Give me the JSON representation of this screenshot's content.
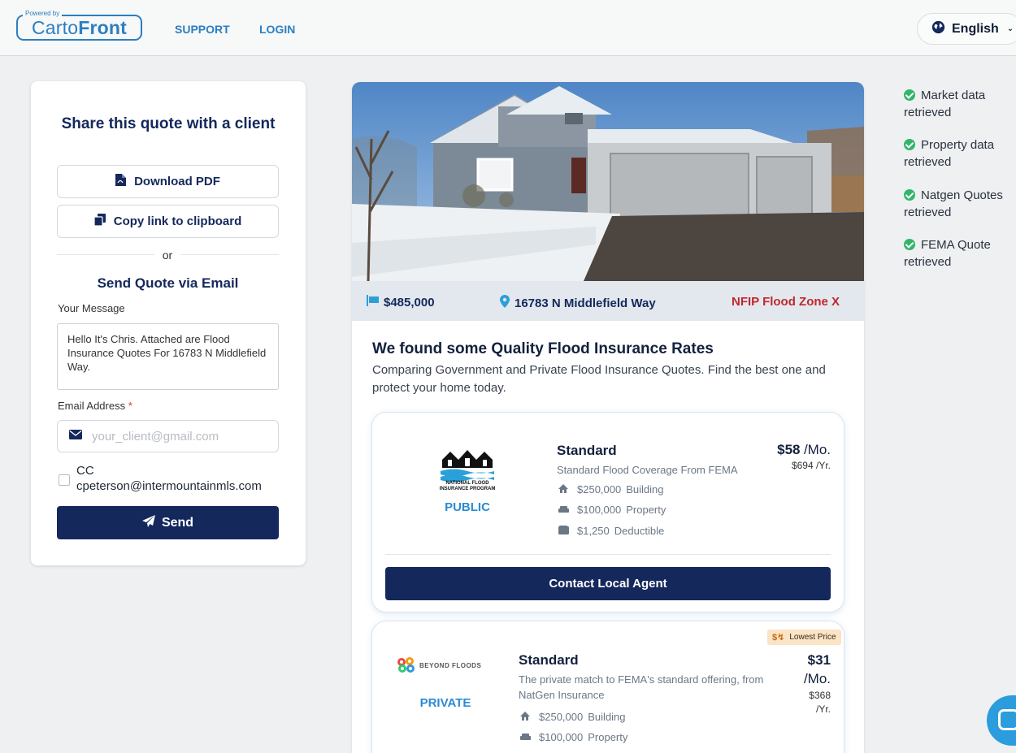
{
  "header": {
    "logo_powered": "Powered by",
    "logo_carto": "Carto",
    "logo_front": "Front",
    "nav": [
      {
        "label": "SUPPORT"
      },
      {
        "label": "LOGIN"
      }
    ],
    "language": "English"
  },
  "share": {
    "title": "Share this quote with a client",
    "download_label": "Download PDF",
    "copy_label": "Copy link to clipboard",
    "or_text": "or",
    "email_section_title": "Send Quote via Email",
    "message_label": "Your Message",
    "message_value": "Hello It's Chris. Attached are Flood Insurance Quotes For 16783 N Middlefield Way.",
    "email_label": "Email Address",
    "email_required": "*",
    "email_placeholder": "your_client@gmail.com",
    "cc_prefix": "CC",
    "cc_email": "cpeterson@intermountainmls.com",
    "send_label": "Send"
  },
  "property": {
    "price": "$485,000",
    "address": "16783 N Middlefield Way",
    "flood_zone": "NFIP Flood Zone X"
  },
  "results": {
    "title": "We found some Quality Flood Insurance Rates",
    "subtitle": "Comparing Government and Private Flood Insurance Quotes. Find the best one and protect your home today."
  },
  "quotes": [
    {
      "provider_logo_text": "NATIONAL FLOOD INSURANCE PROGRAM",
      "kind": "PUBLIC",
      "plan": "Standard",
      "description": "Standard Flood Coverage From FEMA",
      "price_monthly": "$58",
      "per_month": "/Mo.",
      "price_yearly": "$694 /Yr.",
      "features": [
        {
          "icon": "home-icon",
          "amount": "$250,000",
          "label": "Building"
        },
        {
          "icon": "sofa-icon",
          "amount": "$100,000",
          "label": "Property"
        },
        {
          "icon": "wallet-icon",
          "amount": "$1,250",
          "label": "Deductible"
        }
      ],
      "cta": "Contact Local Agent"
    },
    {
      "provider_logo_text": "BEYOND FLOODS",
      "kind": "PRIVATE",
      "badge": "Lowest Price",
      "plan": "Standard",
      "description": "The private match to FEMA's standard offering, from NatGen Insurance",
      "price_monthly": "$31",
      "per_month": "/Mo.",
      "price_yearly": "$368",
      "per_year": "/Yr.",
      "features": [
        {
          "icon": "home-icon",
          "amount": "$250,000",
          "label": "Building"
        },
        {
          "icon": "sofa-icon",
          "amount": "$100,000",
          "label": "Property"
        }
      ]
    }
  ],
  "status": [
    {
      "line1": "Market data",
      "line2": "retrieved"
    },
    {
      "line1": "Property data",
      "line2": "retrieved"
    },
    {
      "line1": "Natgen Quotes",
      "line2": "retrieved"
    },
    {
      "line1": "FEMA Quote",
      "line2": "retrieved"
    }
  ],
  "colors": {
    "navy": "#14285c",
    "brand_blue": "#2b7fc1",
    "zone_red": "#c0272d",
    "check_green": "#32b56a",
    "badge_bg": "#fbe3c5"
  }
}
